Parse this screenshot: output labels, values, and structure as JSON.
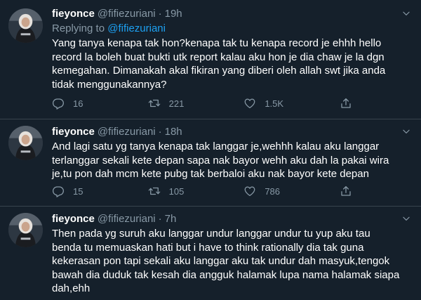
{
  "tweets": [
    {
      "name": "fieyonce",
      "handle": "@fifiezuriani",
      "sep": "·",
      "time": "19h",
      "reply_prefix": "Replying to ",
      "reply_to": "@fifiezuriani",
      "text": "Yang tanya kenapa tak hon?kenapa tak tu kenapa record je ehhh hello\nrecord la boleh buat bukti utk report kalau aku hon je dia chaw je la dgn\nkemegahan. Dimanakah akal fikiran yang diberi oleh allah swt jika anda\ntidak menggunakannya?",
      "replies": "16",
      "retweets": "221",
      "likes": "1.5K"
    },
    {
      "name": "fieyonce",
      "handle": "@fifiezuriani",
      "sep": "·",
      "time": "18h",
      "text": "And lagi satu yg tanya kenapa tak langgar je,wehhh kalau aku langgar\nterlanggar sekali kete depan sapa nak bayor wehh aku dah la pakai wira\nje,tu pon dah mcm kete pubg tak berbaloi aku nak bayor kete depan",
      "replies": "15",
      "retweets": "105",
      "likes": "786"
    },
    {
      "name": "fieyonce",
      "handle": "@fifiezuriani",
      "sep": "·",
      "time": "7h",
      "text": "Then pada yg suruh aku langgar undur langgar undur tu yup aku tau\nbenda tu memuaskan hati but i have to think rationally dia tak guna\nkekerasan pon tapi sekali aku langgar aku tak undur dah masyuk,tengok\nbawah dia duduk tak kesah dia angguk halamak lupa nama halamak siapa\ndah,ehh"
    }
  ],
  "colors": {
    "background": "#15202b",
    "muted": "#8899a6",
    "link": "#1da1f2",
    "divider": "#38444d"
  }
}
